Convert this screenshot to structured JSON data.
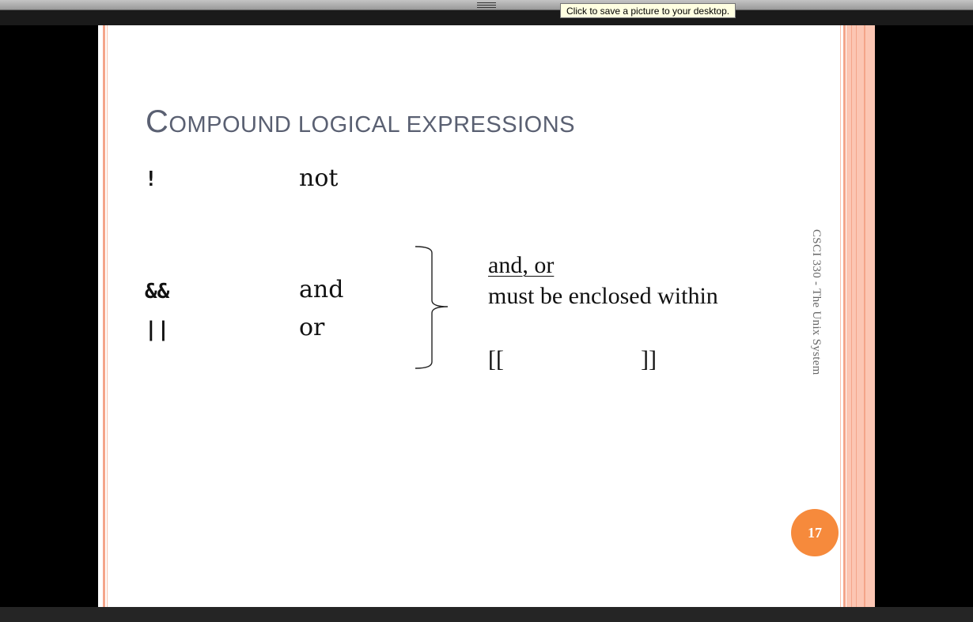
{
  "viewer": {
    "tooltip": "Click to save a picture to your desktop."
  },
  "slide": {
    "title_initial": "C",
    "title_rest": "OMPOUND LOGICAL EXPRESSIONS",
    "operators": [
      {
        "symbol": "!",
        "meaning": "not"
      },
      {
        "symbol": "&&",
        "meaning": "and"
      },
      {
        "symbol": "||",
        "meaning": "or"
      }
    ],
    "note_heading": "and, or",
    "note_line": "must be enclosed within",
    "bracket_open": "[[",
    "bracket_close": "]]",
    "side_text": "CSCI 330 - The Unix System",
    "page_number": "17"
  },
  "colors": {
    "accent_orange": "#f68a3c",
    "band_peach": "#fcc6b3",
    "rule_salmon": "#f4a58a",
    "title_gray": "#5a6072"
  }
}
